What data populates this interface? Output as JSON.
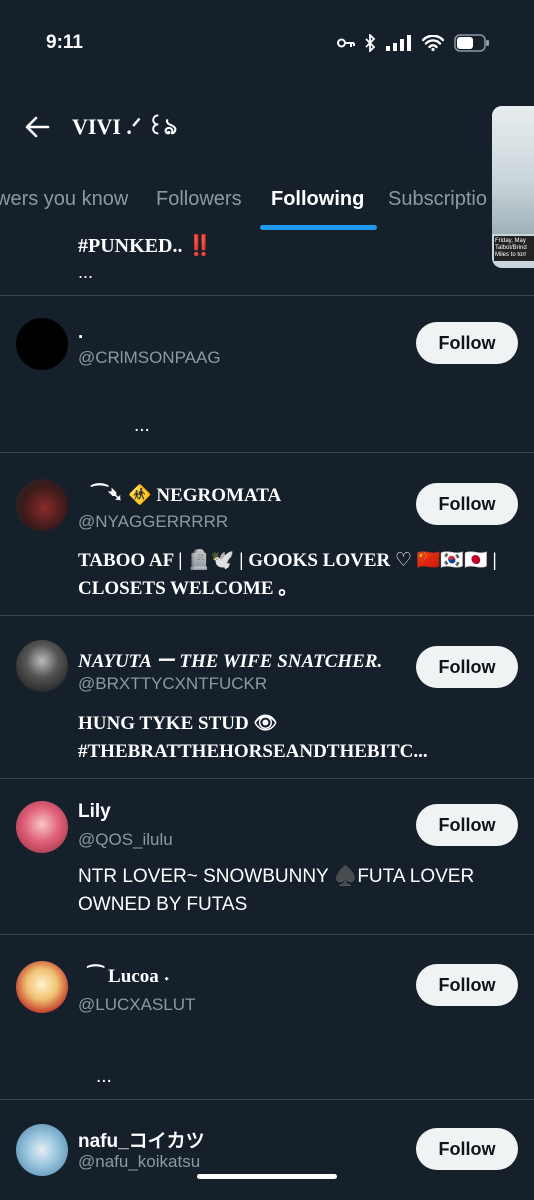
{
  "status_bar": {
    "time": "9:11"
  },
  "header": {
    "profile_name": "VIVI .ᐟ ꒰ঌ"
  },
  "tabs": [
    {
      "label": "wers you know"
    },
    {
      "label": "Followers"
    },
    {
      "label": "Following"
    },
    {
      "label": "Subscriptio"
    }
  ],
  "pip_caption": "Friday, May Talbot/Brind Miles to torr",
  "feed": {
    "prev_bio_tail": "#PUNKED.. ‼️",
    "prev_bio_more": "...",
    "users": [
      {
        "name": ".",
        "handle": "@CRlMSONPAAG",
        "bio": "...",
        "follow_label": "Follow",
        "avatar_color": "#000000"
      },
      {
        "name": "⁀➴ 🚸 NEGROMATA",
        "handle": "@NYAGGERRRRR",
        "bio": "TABOO AF | 🪦🕊️ | GOOKS LOVER ♡ 🇨🇳🇰🇷🇯🇵 | CLOSETS WELCOME 。",
        "follow_label": "Follow",
        "avatar_color": "#3a1a1a"
      },
      {
        "name": "NAYUTA ー THE WIFE SNATCHER.",
        "handle": "@BRXTTYCXNTFUCKR",
        "bio": "HUNG TYKE STUD 👁 #THEBRATTHEHORSEANDTHEBITC...",
        "follow_label": "Follow",
        "avatar_color": "#222222"
      },
      {
        "name": "Lily",
        "handle": "@QOS_ilulu",
        "bio": "NTR LOVER~ SNOWBUNNY ♠️FUTA LOVER OWNED BY FUTAS",
        "follow_label": "Follow",
        "avatar_color": "#e0607a"
      },
      {
        "name": "⁀ Lucoa ˖",
        "handle": "@LUCXASLUT",
        "bio": "...",
        "follow_label": "Follow",
        "avatar_color": "#f0c070"
      },
      {
        "name": "nafu_コイカツ",
        "handle": "@nafu_koikatsu",
        "bio": "",
        "follow_label": "Follow",
        "avatar_color": "#6fb7d8"
      }
    ]
  }
}
